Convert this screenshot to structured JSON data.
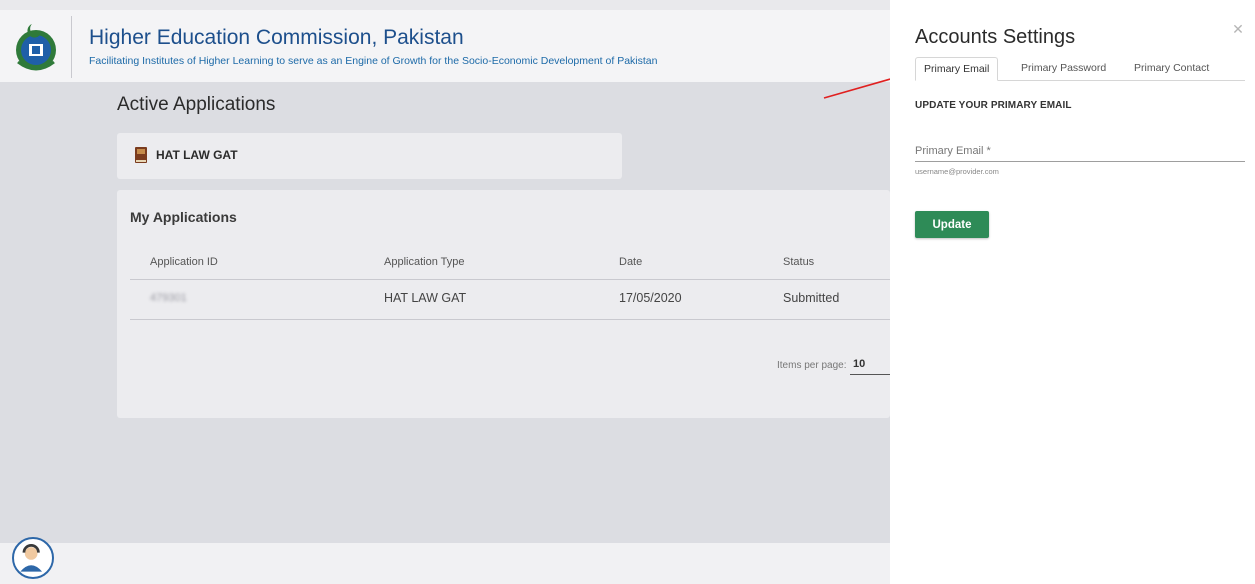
{
  "header": {
    "title": "Higher Education Commission, Pakistan",
    "tagline": "Facilitating Institutes of Higher Learning to serve as an Engine of Growth for the Socio-Economic Development of Pakistan"
  },
  "main": {
    "section_title": "Active Applications",
    "active_app_label": "HAT LAW GAT",
    "my_applications": {
      "title": "My Applications",
      "columns": [
        "Application ID",
        "Application Type",
        "Date",
        "Status"
      ],
      "rows": [
        [
          "479301",
          "HAT LAW GAT",
          "17/05/2020",
          "Submitted"
        ]
      ],
      "items_per_page_label": "Items per page:",
      "items_per_page_value": "10"
    }
  },
  "settings_panel": {
    "title": "Accounts Settings",
    "close_icon": "close-icon",
    "tabs": [
      {
        "label": "Primary Email",
        "active": true
      },
      {
        "label": "Primary Password",
        "active": false
      },
      {
        "label": "Primary Contact",
        "active": false
      }
    ],
    "form_heading": "UPDATE YOUR PRIMARY EMAIL",
    "email_label": "Primary Email *",
    "email_hint": "username@provider.com",
    "update_label": "Update"
  },
  "colors": {
    "brand_blue": "#1d4f8c",
    "update_green": "#2e8b57",
    "annotation_arrow": "#e02020"
  },
  "icons": [
    "hec-logo",
    "book-icon",
    "close-icon",
    "support-agent-icon",
    "annotation-arrow"
  ]
}
